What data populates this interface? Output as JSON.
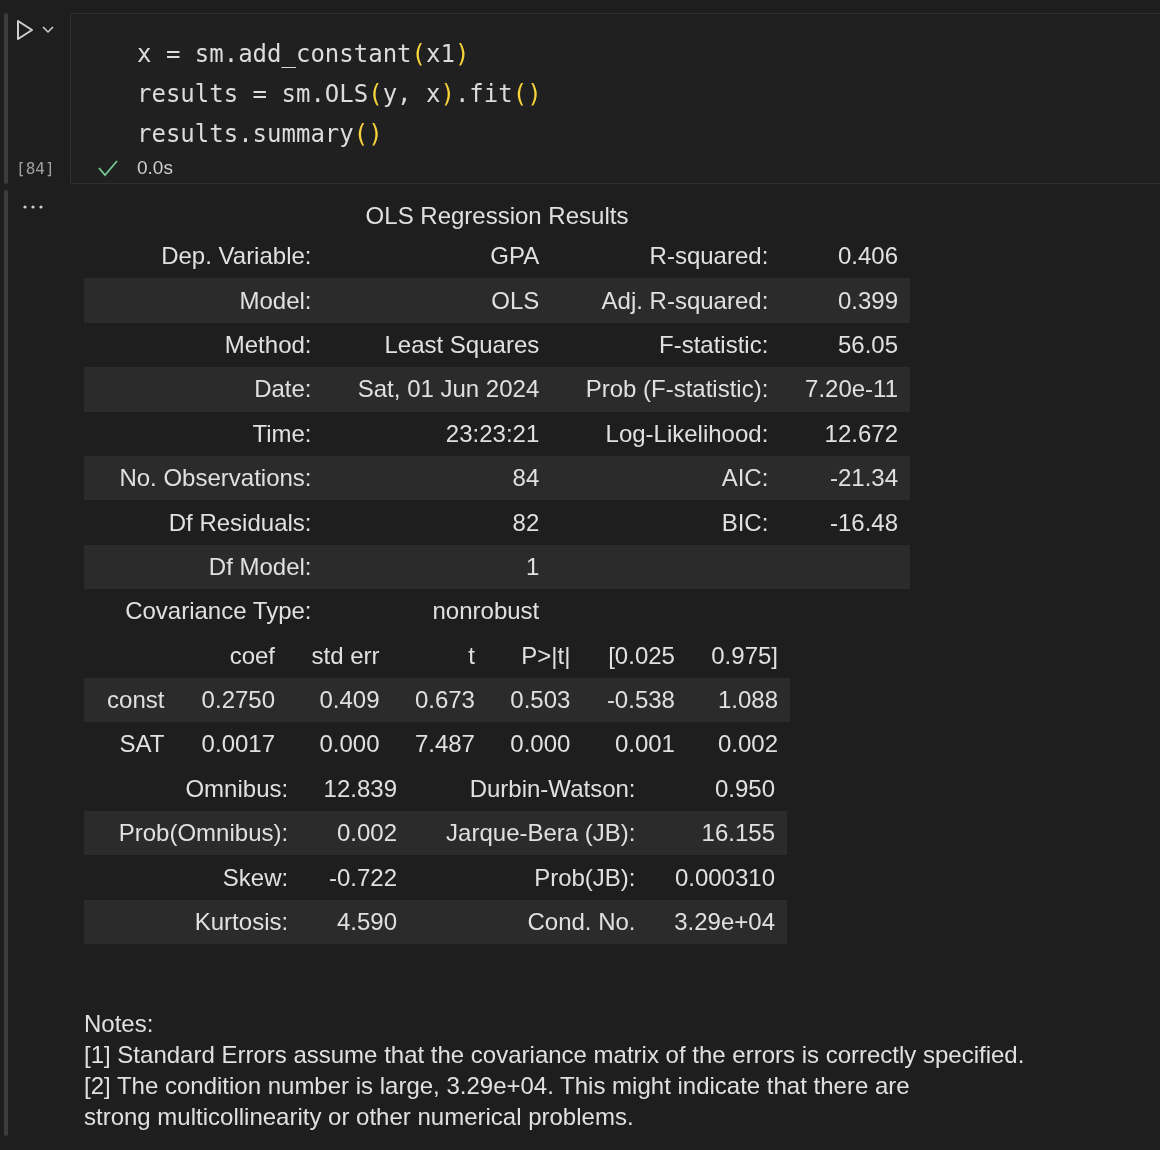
{
  "cell": {
    "execution_count": "[84]",
    "code_lines": [
      [
        {
          "kind": "plain",
          "text": "x = sm.add_constant"
        },
        {
          "kind": "bracket",
          "text": "("
        },
        {
          "kind": "plain",
          "text": "x1"
        },
        {
          "kind": "bracket",
          "text": ")"
        }
      ],
      [
        {
          "kind": "plain",
          "text": "results = sm.OLS"
        },
        {
          "kind": "bracket",
          "text": "("
        },
        {
          "kind": "plain",
          "text": "y, x"
        },
        {
          "kind": "bracket",
          "text": ")"
        },
        {
          "kind": "plain",
          "text": ".fit"
        },
        {
          "kind": "bracket",
          "text": "()"
        }
      ],
      [
        {
          "kind": "plain",
          "text": "results.summary"
        },
        {
          "kind": "bracket",
          "text": "()"
        }
      ]
    ],
    "status": {
      "succeeded": true,
      "duration": "0.0s"
    }
  },
  "output": {
    "title": "OLS Regression Results",
    "summary_rows": [
      [
        "Dep. Variable:",
        "GPA",
        "R-squared:",
        "0.406"
      ],
      [
        "Model:",
        "OLS",
        "Adj. R-squared:",
        "0.399"
      ],
      [
        "Method:",
        "Least Squares",
        "F-statistic:",
        "56.05"
      ],
      [
        "Date:",
        "Sat, 01 Jun 2024",
        "Prob (F-statistic):",
        "7.20e-11"
      ],
      [
        "Time:",
        "23:23:21",
        "Log-Likelihood:",
        "12.672"
      ],
      [
        "No. Observations:",
        "84",
        "AIC:",
        "-21.34"
      ],
      [
        "Df Residuals:",
        "82",
        "BIC:",
        "-16.48"
      ],
      [
        "Df Model:",
        "1"
      ],
      [
        "Covariance Type:",
        "nonrobust"
      ]
    ],
    "coef_table": {
      "columns": [
        "coef",
        "std err",
        "t",
        "P>|t|",
        "[0.025",
        "0.975]"
      ],
      "rows": [
        {
          "name": "const",
          "values": [
            "0.2750",
            "0.409",
            "0.673",
            "0.503",
            "-0.538",
            "1.088"
          ]
        },
        {
          "name": "SAT",
          "values": [
            "0.0017",
            "0.000",
            "7.487",
            "0.000",
            "0.001",
            "0.002"
          ]
        }
      ]
    },
    "diagnostics_rows": [
      [
        "Omnibus:",
        "12.839",
        "Durbin-Watson:",
        "0.950"
      ],
      [
        "Prob(Omnibus):",
        "0.002",
        "Jarque-Bera (JB):",
        "16.155"
      ],
      [
        "Skew:",
        "-0.722",
        "Prob(JB):",
        "0.000310"
      ],
      [
        "Kurtosis:",
        "4.590",
        "Cond. No.",
        "3.29e+04"
      ]
    ],
    "notes": [
      "Notes:",
      "[1] Standard Errors assume that the covariance matrix of the errors is correctly specified.",
      "[2] The condition number is large, 3.29e+04. This might indicate that there are",
      "strong multicollinearity or other numerical problems."
    ]
  }
}
